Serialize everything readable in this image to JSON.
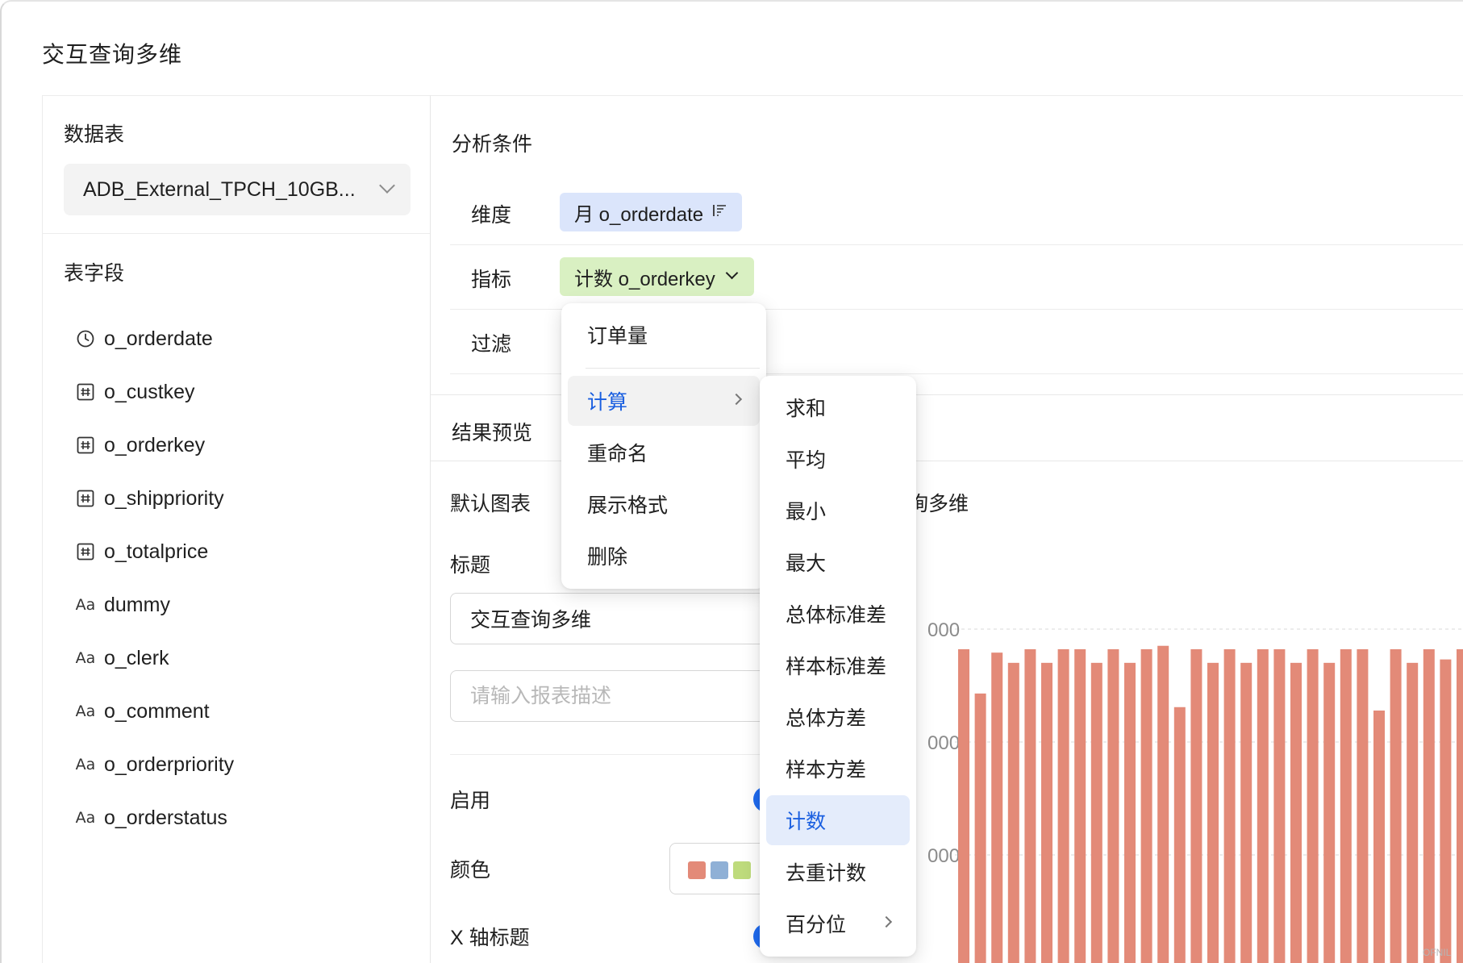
{
  "app_title": "交互查询多维",
  "left": {
    "table_heading": "数据表",
    "table_value": "ADB_External_TPCH_10GB...",
    "fields_heading": "表字段",
    "fields": [
      {
        "icon": "clock-icon",
        "name": "o_orderdate"
      },
      {
        "icon": "number-icon",
        "name": "o_custkey"
      },
      {
        "icon": "number-icon",
        "name": "o_orderkey"
      },
      {
        "icon": "number-icon",
        "name": "o_shippriority"
      },
      {
        "icon": "number-icon",
        "name": "o_totalprice"
      },
      {
        "icon": "text-icon",
        "name": "dummy"
      },
      {
        "icon": "text-icon",
        "name": "o_clerk"
      },
      {
        "icon": "text-icon",
        "name": "o_comment"
      },
      {
        "icon": "text-icon",
        "name": "o_orderpriority"
      },
      {
        "icon": "text-icon",
        "name": "o_orderstatus"
      }
    ],
    "text_icon_glyph": "Aa"
  },
  "analysis": {
    "heading": "分析条件",
    "dimension_label": "维度",
    "dimension_chip": "月 o_orderdate",
    "metric_label": "指标",
    "metric_chip": "计数 o_orderkey",
    "filter_label": "过滤"
  },
  "preview": {
    "heading": "结果预览",
    "default_chart_label": "默认图表",
    "title_label": "标题",
    "title_value": "交互查询多维",
    "description_placeholder": "请输入报表描述",
    "enable_label": "启用",
    "color_label": "颜色",
    "xaxis_title_label": "X 轴标题",
    "chart_title_partial": "询多维",
    "swatch_colors": [
      "#e38a78",
      "#8fb0d6",
      "#bedb7c"
    ]
  },
  "menu_primary": {
    "items": [
      "订单量",
      "计算",
      "重命名",
      "展示格式",
      "删除"
    ],
    "active": "计算"
  },
  "menu_secondary": {
    "items": [
      "求和",
      "平均",
      "最小",
      "最大",
      "总体标准差",
      "样本标准差",
      "总体方差",
      "样本方差",
      "计数",
      "去重计数",
      "百分位"
    ],
    "selected": "计数"
  },
  "chart_data": {
    "type": "bar",
    "color": "#e38a78",
    "ytick_labels_partial": [
      "000",
      "000",
      "000"
    ],
    "values": [
      0.94,
      0.81,
      0.93,
      0.9,
      0.94,
      0.9,
      0.94,
      0.94,
      0.9,
      0.94,
      0.9,
      0.94,
      0.95,
      0.77,
      0.94,
      0.9,
      0.94,
      0.9,
      0.94,
      0.94,
      0.9,
      0.94,
      0.9,
      0.94,
      0.94,
      0.76,
      0.94,
      0.9,
      0.94,
      0.91,
      0.94
    ]
  },
  "watermark": "OFNIL"
}
